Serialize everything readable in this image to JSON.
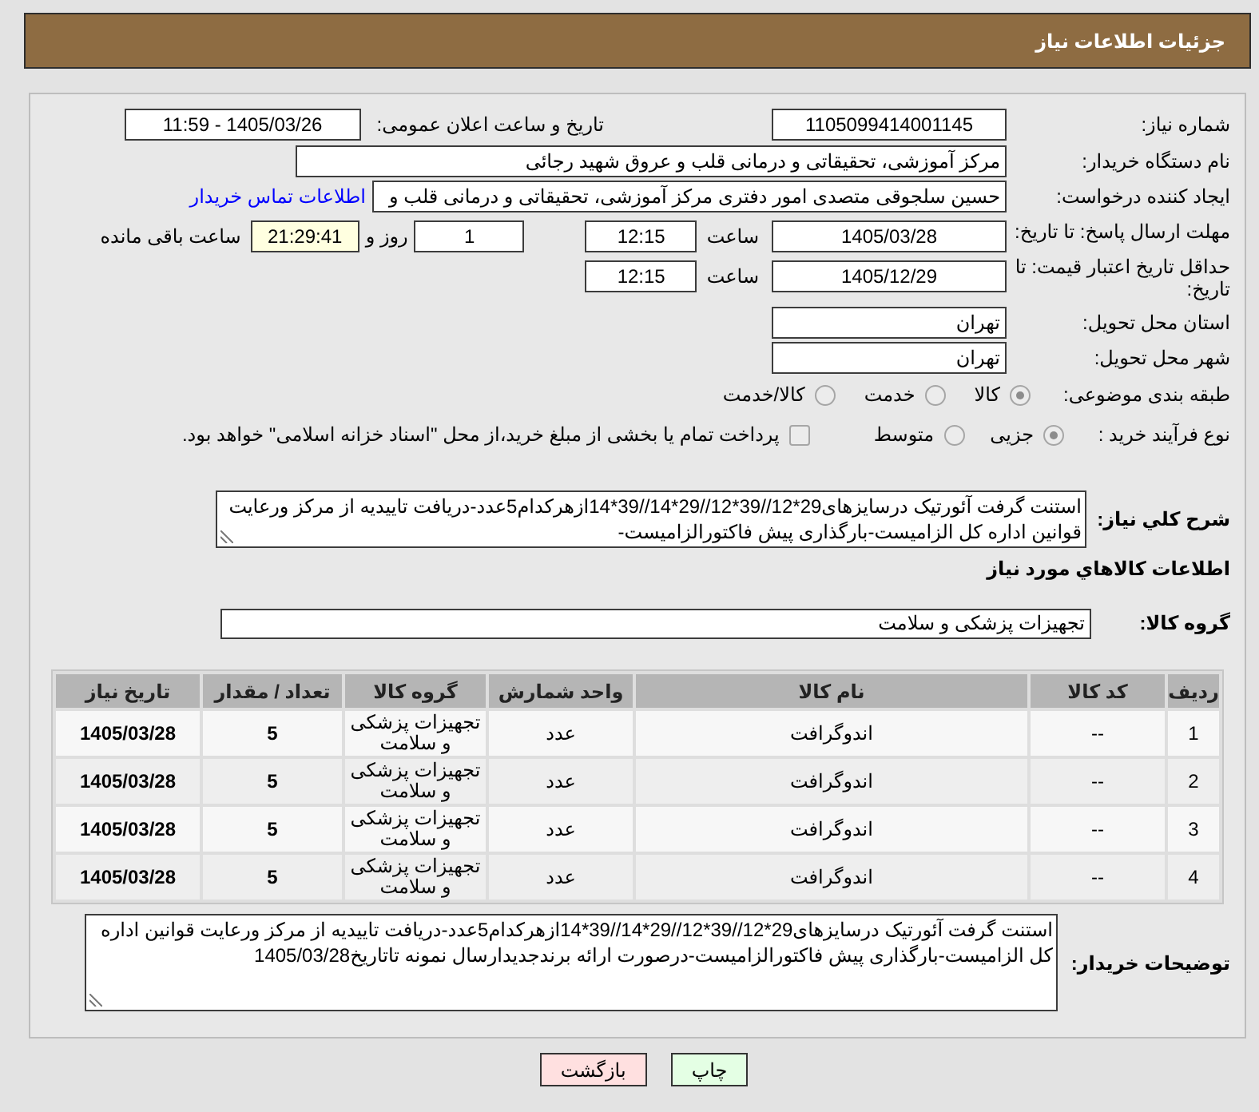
{
  "header": {
    "title": "جزئیات اطلاعات نیاز"
  },
  "details": {
    "need_number": {
      "label": "شماره نیاز:",
      "value": "1105099414001145"
    },
    "announcement": {
      "label": "تاریخ و ساعت اعلان عمومی:",
      "value": "1405/03/26 - 11:59"
    },
    "buyer_org": {
      "label": "نام دستگاه خریدار:",
      "value": "مرکز آموزشی، تحقیقاتی و درمانی قلب و عروق شهید رجائی"
    },
    "requester": {
      "label": "ایجاد کننده درخواست:",
      "value": "حسین سلجوقی متصدی امور دفتری مرکز آموزشی، تحقیقاتی و درمانی قلب و",
      "link": "اطلاعات تماس خریدار"
    },
    "reply_deadline": {
      "label": "مهلت ارسال پاسخ: تا تاریخ:",
      "date": "1405/03/28",
      "time_label": "ساعت",
      "time": "12:15",
      "days": "1",
      "days_label": "روز و",
      "remaining": "21:29:41",
      "remaining_label": "ساعت باقی مانده"
    },
    "price_validity": {
      "label": "حداقل تاریخ اعتبار قیمت: تا تاریخ:",
      "date": "1405/12/29",
      "time_label": "ساعت",
      "time": "12:15"
    },
    "province": {
      "label": "استان محل تحویل:",
      "value": "تهران"
    },
    "city": {
      "label": "شهر محل تحویل:",
      "value": "تهران"
    },
    "category": {
      "label": "طبقه بندی موضوعی:",
      "options": [
        {
          "label": "کالا",
          "selected": true
        },
        {
          "label": "خدمت",
          "selected": false
        },
        {
          "label": "کالا/خدمت",
          "selected": false
        }
      ]
    },
    "purchase_type": {
      "label": "نوع فرآیند خرید :",
      "options": [
        {
          "label": "جزیی",
          "selected": true
        },
        {
          "label": "متوسط",
          "selected": false
        }
      ],
      "treasury": {
        "label": "پرداخت تمام یا بخشی از مبلغ خرید،از محل \"اسناد خزانه اسلامی\" خواهد بود.",
        "checked": false
      }
    },
    "description": {
      "label": "شرح کلي نياز:",
      "value": "استنت گرفت آئورتیک درسایزهای29*12//39*12//29*14//39*14ازهرکدام5عدد-دریافت تاییدیه از مرکز ورعایت قوانین اداره کل الزامیست-بارگذاری پیش فاکتورالزامیست-"
    }
  },
  "goods": {
    "title": "اطلاعات کالاهاي مورد نياز",
    "group": {
      "label": "گروه کالا:",
      "value": "تجهیزات پزشکی و سلامت"
    },
    "table": {
      "columns": [
        "ردیف",
        "کد کالا",
        "نام کالا",
        "واحد شمارش",
        "گروه کالا",
        "تعداد / مقدار",
        "تاریخ نیاز"
      ],
      "rows": [
        [
          "1",
          "--",
          "اندوگرافت",
          "عدد",
          "تجهیزات پزشکی و سلامت",
          "5",
          "1405/03/28"
        ],
        [
          "2",
          "--",
          "اندوگرافت",
          "عدد",
          "تجهیزات پزشکی و سلامت",
          "5",
          "1405/03/28"
        ],
        [
          "3",
          "--",
          "اندوگرافت",
          "عدد",
          "تجهیزات پزشکی و سلامت",
          "5",
          "1405/03/28"
        ],
        [
          "4",
          "--",
          "اندوگرافت",
          "عدد",
          "تجهیزات پزشکی و سلامت",
          "5",
          "1405/03/28"
        ]
      ]
    }
  },
  "buyer_notes": {
    "label": "توضیحات خریدار:",
    "value": "استنت گرفت آئورتیک درسایزهای29*12//39*12//29*14//39*14ازهرکدام5عدد-دریافت تاییدیه از مرکز ورعایت قوانین اداره کل الزامیست-بارگذاری پیش فاکتورالزامیست-درصورت ارائه برندجدیدارسال نمونه تاتاریخ1405/03/28"
  },
  "buttons": [
    {
      "label": "چاپ",
      "kind": "print"
    },
    {
      "label": "بازگشت",
      "kind": "back"
    }
  ]
}
